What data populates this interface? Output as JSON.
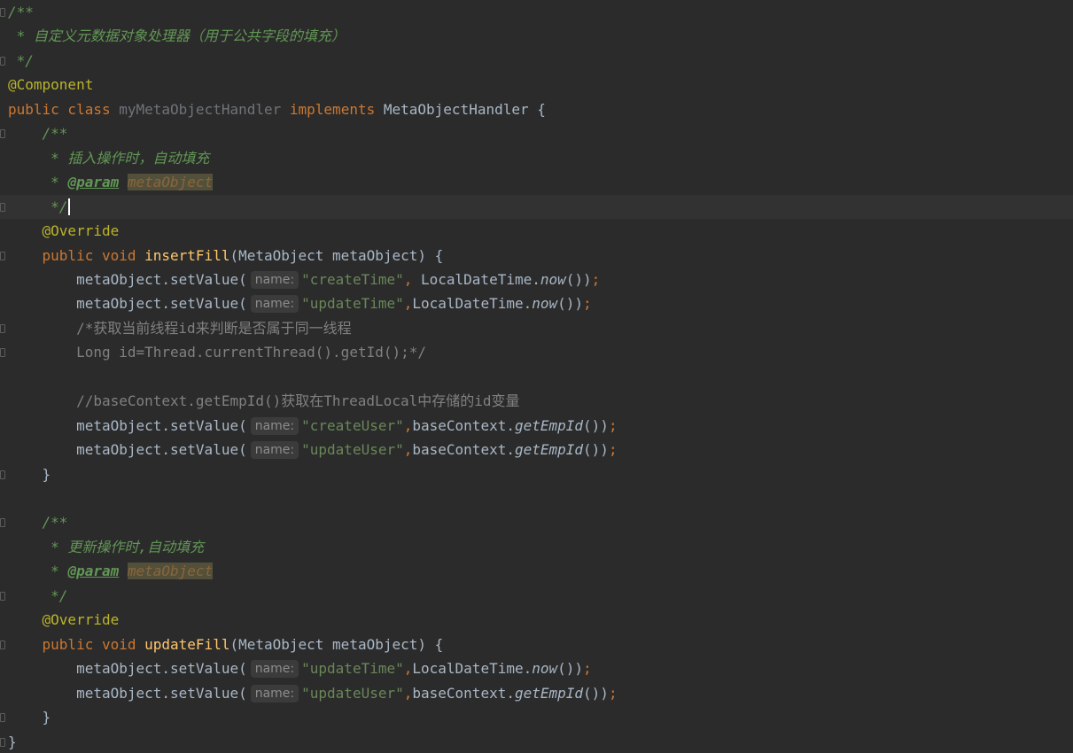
{
  "editor": {
    "lines": [
      {
        "parts": [
          {
            "t": "/**",
            "c": "doc"
          }
        ]
      },
      {
        "parts": [
          {
            "t": " * 自定义元数据对象处理器（用于公共字段的填充）",
            "c": "doc"
          }
        ]
      },
      {
        "parts": [
          {
            "t": " */",
            "c": "doc"
          }
        ]
      },
      {
        "parts": [
          {
            "t": "@Component",
            "c": "ann"
          }
        ]
      },
      {
        "parts": [
          {
            "t": "public class ",
            "c": "kw"
          },
          {
            "t": "myMetaObjectHandler ",
            "c": "cls-dim"
          },
          {
            "t": "implements ",
            "c": "kw"
          },
          {
            "t": "MetaObjectHandler {",
            "c": ""
          }
        ]
      },
      {
        "parts": [
          {
            "t": "    /**",
            "c": "doc"
          }
        ]
      },
      {
        "parts": [
          {
            "t": "     * 插入操作时，自动填充",
            "c": "doc"
          }
        ]
      },
      {
        "parts": [
          {
            "t": "     * ",
            "c": "doc"
          },
          {
            "t": "@param",
            "c": "doc-tag"
          },
          {
            "t": " ",
            "c": "doc"
          },
          {
            "t": "metaObject",
            "c": "doc-param"
          }
        ]
      },
      {
        "parts": [
          {
            "t": "     */",
            "c": "doc"
          }
        ],
        "caret": true,
        "current": true
      },
      {
        "parts": [
          {
            "t": "    @Override",
            "c": "ann"
          }
        ]
      },
      {
        "parts": [
          {
            "t": "    public void ",
            "c": "kw"
          },
          {
            "t": "insertFill",
            "c": "fn"
          },
          {
            "t": "(MetaObject metaObject) {",
            "c": ""
          }
        ]
      },
      {
        "parts": [
          {
            "t": "        metaObject.setValue(",
            "c": ""
          },
          {
            "hint": "name:"
          },
          {
            "t": "\"createTime\"",
            "c": "str"
          },
          {
            "t": ", ",
            "c": "kw"
          },
          {
            "t": "LocalDateTime.",
            "c": ""
          },
          {
            "t": "now",
            "c": "ital"
          },
          {
            "t": "())",
            "c": ""
          },
          {
            "t": ";",
            "c": "semi"
          }
        ]
      },
      {
        "parts": [
          {
            "t": "        metaObject.setValue(",
            "c": ""
          },
          {
            "hint": "name:"
          },
          {
            "t": "\"updateTime\"",
            "c": "str"
          },
          {
            "t": ",",
            "c": "kw"
          },
          {
            "t": "LocalDateTime.",
            "c": ""
          },
          {
            "t": "now",
            "c": "ital"
          },
          {
            "t": "())",
            "c": ""
          },
          {
            "t": ";",
            "c": "semi"
          }
        ]
      },
      {
        "parts": [
          {
            "t": "        /*获取当前线程id来判断是否属于同一线程",
            "c": "cmt"
          }
        ]
      },
      {
        "parts": [
          {
            "t": "        Long id=Thread.currentThread().getId();*/",
            "c": "cmt"
          }
        ]
      },
      {
        "parts": [
          {
            "t": "",
            "c": ""
          }
        ]
      },
      {
        "parts": [
          {
            "t": "        //baseContext.getEmpId()获取在ThreadLocal中存储的id变量",
            "c": "cmt"
          }
        ]
      },
      {
        "parts": [
          {
            "t": "        metaObject.setValue(",
            "c": ""
          },
          {
            "hint": "name:"
          },
          {
            "t": "\"createUser\"",
            "c": "str"
          },
          {
            "t": ",",
            "c": "kw"
          },
          {
            "t": "baseContext.",
            "c": ""
          },
          {
            "t": "getEmpId",
            "c": "ital"
          },
          {
            "t": "())",
            "c": ""
          },
          {
            "t": ";",
            "c": "semi"
          }
        ]
      },
      {
        "parts": [
          {
            "t": "        metaObject.setValue(",
            "c": ""
          },
          {
            "hint": "name:"
          },
          {
            "t": "\"updateUser\"",
            "c": "str"
          },
          {
            "t": ",",
            "c": "kw"
          },
          {
            "t": "baseContext.",
            "c": ""
          },
          {
            "t": "getEmpId",
            "c": "ital"
          },
          {
            "t": "())",
            "c": ""
          },
          {
            "t": ";",
            "c": "semi"
          }
        ]
      },
      {
        "parts": [
          {
            "t": "    }",
            "c": ""
          }
        ]
      },
      {
        "parts": [
          {
            "t": "",
            "c": ""
          }
        ]
      },
      {
        "parts": [
          {
            "t": "    /**",
            "c": "doc"
          }
        ]
      },
      {
        "parts": [
          {
            "t": "     * 更新操作时,自动填充",
            "c": "doc"
          }
        ]
      },
      {
        "parts": [
          {
            "t": "     * ",
            "c": "doc"
          },
          {
            "t": "@param",
            "c": "doc-tag"
          },
          {
            "t": " ",
            "c": "doc"
          },
          {
            "t": "metaObject",
            "c": "doc-param"
          }
        ]
      },
      {
        "parts": [
          {
            "t": "     */",
            "c": "doc"
          }
        ]
      },
      {
        "parts": [
          {
            "t": "    @Override",
            "c": "ann"
          }
        ]
      },
      {
        "parts": [
          {
            "t": "    public void ",
            "c": "kw"
          },
          {
            "t": "updateFill",
            "c": "fn"
          },
          {
            "t": "(MetaObject metaObject) {",
            "c": ""
          }
        ]
      },
      {
        "parts": [
          {
            "t": "        metaObject.setValue(",
            "c": ""
          },
          {
            "hint": "name:"
          },
          {
            "t": "\"updateTime\"",
            "c": "str"
          },
          {
            "t": ",",
            "c": "kw"
          },
          {
            "t": "LocalDateTime.",
            "c": ""
          },
          {
            "t": "now",
            "c": "ital"
          },
          {
            "t": "())",
            "c": ""
          },
          {
            "t": ";",
            "c": "semi"
          }
        ]
      },
      {
        "parts": [
          {
            "t": "        metaObject.setValue(",
            "c": ""
          },
          {
            "hint": "name:"
          },
          {
            "t": "\"updateUser\"",
            "c": "str"
          },
          {
            "t": ",",
            "c": "kw"
          },
          {
            "t": "baseContext.",
            "c": ""
          },
          {
            "t": "getEmpId",
            "c": "ital"
          },
          {
            "t": "())",
            "c": ""
          },
          {
            "t": ";",
            "c": "semi"
          }
        ]
      },
      {
        "parts": [
          {
            "t": "    }",
            "c": ""
          }
        ]
      },
      {
        "parts": [
          {
            "t": "}",
            "c": ""
          }
        ]
      }
    ],
    "gutter_icons": [
      "intention-bulb-icon"
    ],
    "colors": {
      "background": "#2b2b2b",
      "keyword": "#cc7832",
      "annotation": "#bbb529",
      "string": "#6a8759",
      "doc_comment": "#629755",
      "comment": "#808080",
      "method": "#ffc66d"
    }
  }
}
